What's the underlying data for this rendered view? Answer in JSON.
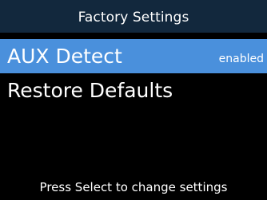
{
  "header": {
    "title": "Factory Settings"
  },
  "menu": {
    "items": [
      {
        "label": "AUX Detect",
        "value": "enabled",
        "selected": true
      },
      {
        "label": "Restore Defaults",
        "value": "",
        "selected": false
      }
    ]
  },
  "footer": {
    "hint": "Press Select to change settings"
  },
  "colors": {
    "background": "#000000",
    "header_bg": "#12283d",
    "selection_bg": "#4a90dc",
    "text": "#ffffff"
  }
}
